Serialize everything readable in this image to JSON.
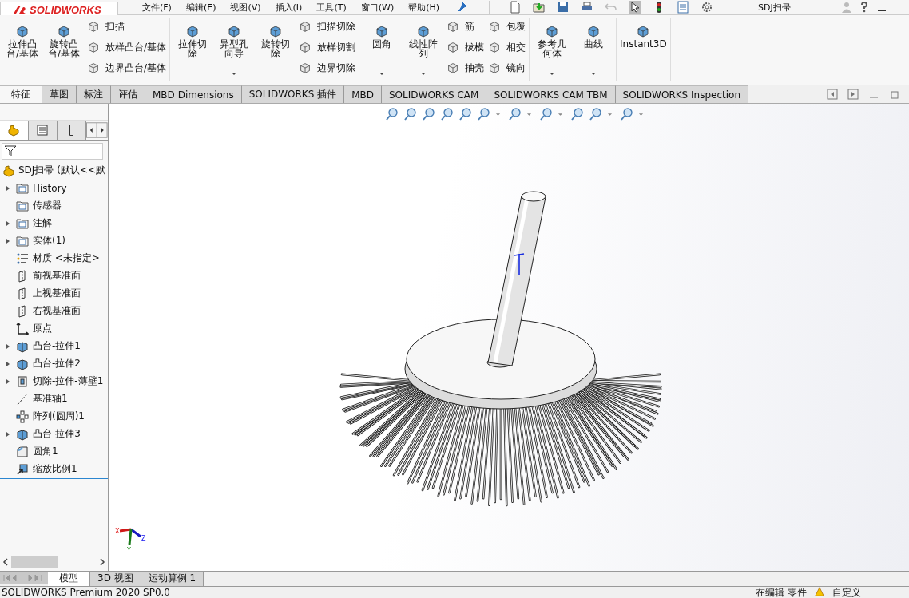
{
  "app": {
    "logo": "SOLIDWORKS",
    "document_title": "SDJ扫帚"
  },
  "menu": [
    "文件(F)",
    "编辑(E)",
    "视图(V)",
    "插入(I)",
    "工具(T)",
    "窗口(W)",
    "帮助(H)"
  ],
  "ribbon": [
    {
      "columns": [
        {
          "kind": "large",
          "label": "拉伸凸台/基体",
          "dropdown": false
        },
        {
          "kind": "large",
          "label": "旋转凸台/基体",
          "dropdown": false
        },
        {
          "kind": "stack",
          "items": [
            "扫描",
            "放样凸台/基体",
            "边界凸台/基体"
          ]
        }
      ]
    },
    {
      "columns": [
        {
          "kind": "large",
          "label": "拉伸切除",
          "dropdown": false
        },
        {
          "kind": "large",
          "label": "异型孔向导",
          "dropdown": true
        },
        {
          "kind": "large",
          "label": "旋转切除",
          "dropdown": false
        },
        {
          "kind": "stack",
          "items": [
            "扫描切除",
            "放样切割",
            "边界切除"
          ]
        }
      ]
    },
    {
      "columns": [
        {
          "kind": "large",
          "label": "圆角",
          "dropdown": true
        },
        {
          "kind": "large",
          "label": "线性阵列",
          "dropdown": true
        },
        {
          "kind": "stack",
          "items": [
            "筋",
            "拔模",
            "抽壳"
          ]
        },
        {
          "kind": "stack",
          "items": [
            "包覆",
            "相交",
            "镜向"
          ]
        }
      ]
    },
    {
      "columns": [
        {
          "kind": "large",
          "label": "参考几何体",
          "dropdown": true
        },
        {
          "kind": "large",
          "label": "曲线",
          "dropdown": true
        }
      ]
    },
    {
      "columns": [
        {
          "kind": "large",
          "label": "Instant3D",
          "dropdown": false
        }
      ]
    }
  ],
  "tabs": [
    {
      "label": "特征",
      "selected": true
    },
    {
      "label": "草图",
      "selected": false
    },
    {
      "label": "标注",
      "selected": false
    },
    {
      "label": "评估",
      "selected": false
    },
    {
      "label": "MBD Dimensions",
      "selected": false
    },
    {
      "label": "SOLIDWORKS 插件",
      "selected": false
    },
    {
      "label": "MBD",
      "selected": false
    },
    {
      "label": "SOLIDWORKS CAM",
      "selected": false
    },
    {
      "label": "SOLIDWORKS CAM TBM",
      "selected": false
    },
    {
      "label": "SOLIDWORKS Inspection",
      "selected": false
    }
  ],
  "tree": {
    "root": "SDJ扫帚  (默认<<默",
    "items": [
      {
        "label": "History",
        "kind": "folder",
        "expandable": true
      },
      {
        "label": "传感器",
        "kind": "folder",
        "expandable": false
      },
      {
        "label": "注解",
        "kind": "folder",
        "expandable": true
      },
      {
        "label": "实体(1)",
        "kind": "folder",
        "expandable": true
      },
      {
        "label": "材质 <未指定>",
        "kind": "material",
        "expandable": false
      },
      {
        "label": "前视基准面",
        "kind": "plane",
        "expandable": false
      },
      {
        "label": "上视基准面",
        "kind": "plane",
        "expandable": false
      },
      {
        "label": "右视基准面",
        "kind": "plane",
        "expandable": false
      },
      {
        "label": "原点",
        "kind": "origin",
        "expandable": false
      },
      {
        "label": "凸台-拉伸1",
        "kind": "feature",
        "expandable": true
      },
      {
        "label": "凸台-拉伸2",
        "kind": "feature",
        "expandable": true
      },
      {
        "label": "切除-拉伸-薄壁1",
        "kind": "cut",
        "expandable": true
      },
      {
        "label": "基准轴1",
        "kind": "axis",
        "expandable": false
      },
      {
        "label": "阵列(圆周)1",
        "kind": "pattern",
        "expandable": false
      },
      {
        "label": "凸台-拉伸3",
        "kind": "feature",
        "expandable": true
      },
      {
        "label": "圆角1",
        "kind": "fillet",
        "expandable": false
      },
      {
        "label": "缩放比例1",
        "kind": "scale",
        "expandable": false
      }
    ]
  },
  "triad": [
    "X",
    "Y",
    "Z"
  ],
  "bottom_tabs": [
    {
      "label": "模型",
      "selected": true
    },
    {
      "label": "3D 视图",
      "selected": false
    },
    {
      "label": "运动算例 1",
      "selected": false
    }
  ],
  "status_bar": {
    "product": "SOLIDWORKS Premium 2020 SP0.0",
    "mode": "在编辑 零件",
    "units": "自定义"
  }
}
